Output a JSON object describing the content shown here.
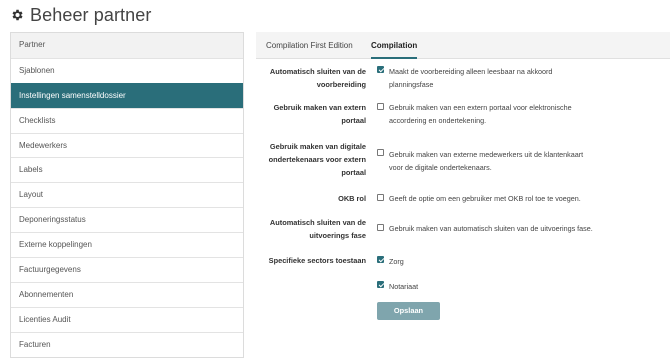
{
  "page": {
    "title": "Beheer partner",
    "icon": "gear-icon"
  },
  "sidebar": {
    "items": [
      {
        "label": "Partner"
      },
      {
        "label": "Sjablonen"
      },
      {
        "label": "Instellingen samenstelldossier",
        "active": true
      },
      {
        "label": "Checklists"
      },
      {
        "label": "Medewerkers"
      },
      {
        "label": "Labels"
      },
      {
        "label": "Layout"
      },
      {
        "label": "Deponeringsstatus"
      },
      {
        "label": "Externe koppelingen"
      },
      {
        "label": "Factuurgegevens"
      },
      {
        "label": "Abonnementen"
      },
      {
        "label": "Licenties Audit"
      },
      {
        "label": "Facturen"
      }
    ]
  },
  "tabs": [
    {
      "label": "Compilation First Edition",
      "active": false
    },
    {
      "label": "Compilation",
      "active": true
    }
  ],
  "settings": [
    {
      "label_lines": [
        "Automatisch sluiten van de",
        "voorbereiding"
      ],
      "checked": true,
      "desc_lines": [
        "Maakt de voorbereiding alleen leesbaar na akkoord",
        "planningsfase"
      ]
    },
    {
      "label_lines": [
        "Gebruik maken van extern",
        "portaal"
      ],
      "checked": false,
      "desc_lines": [
        "Gebruik maken van een extern portaal voor elektronische",
        "accordering en ondertekening."
      ]
    },
    {
      "label_lines": [
        "Gebruik maken van digitale",
        "ondertekenaars voor extern",
        "portaal"
      ],
      "checked": false,
      "desc_lines": [
        "Gebruik maken van externe medewerkers uit de klantenkaart",
        "voor de digitale ondertekenaars."
      ]
    },
    {
      "label_lines": [
        "OKB rol"
      ],
      "checked": false,
      "desc_lines": [
        "Geeft de optie om een gebruiker met OKB rol toe te voegen."
      ]
    },
    {
      "label_lines": [
        "Automatisch sluiten van de",
        "uitvoerings fase"
      ],
      "checked": false,
      "desc_lines": [
        "Gebruik maken van automatisch sluiten van de uitvoerings fase."
      ]
    },
    {
      "label_lines": [
        "Specifieke sectors toestaan"
      ],
      "checked": true,
      "desc_lines": [
        "Zorg"
      ]
    },
    {
      "label_lines": [],
      "checked": true,
      "desc_lines": [
        "Notariaat"
      ]
    }
  ],
  "buttons": {
    "save": "Opslaan"
  },
  "colors": {
    "accent": "#2a6e7a",
    "button": "#7fa5ad"
  }
}
